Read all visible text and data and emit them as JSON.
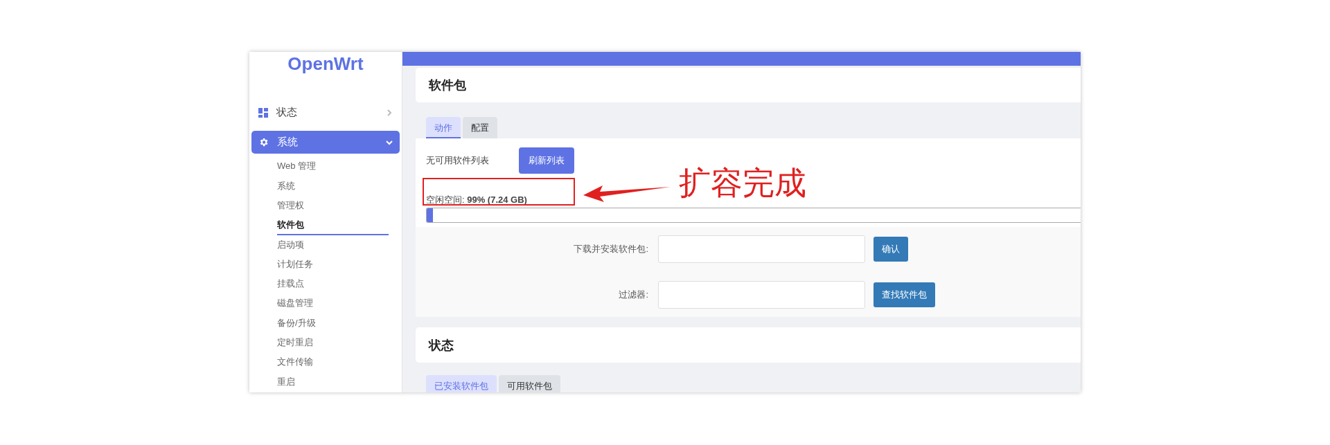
{
  "sidebar": {
    "logo": "OpenWrt",
    "menu": [
      {
        "label": "状态",
        "expanded": false,
        "selected": false
      },
      {
        "label": "系统",
        "expanded": true,
        "selected": true
      }
    ],
    "submenu": [
      {
        "label": "Web 管理",
        "selected": false
      },
      {
        "label": "系统",
        "selected": false
      },
      {
        "label": "管理权",
        "selected": false
      },
      {
        "label": "软件包",
        "selected": true
      },
      {
        "label": "启动项",
        "selected": false
      },
      {
        "label": "计划任务",
        "selected": false
      },
      {
        "label": "挂载点",
        "selected": false
      },
      {
        "label": "磁盘管理",
        "selected": false
      },
      {
        "label": "备份/升级",
        "selected": false
      },
      {
        "label": "定时重启",
        "selected": false
      },
      {
        "label": "文件传输",
        "selected": false
      },
      {
        "label": "重启",
        "selected": false
      }
    ]
  },
  "page_title": "软件包",
  "tabs": [
    {
      "label": "动作",
      "selected": true
    },
    {
      "label": "配置",
      "selected": false
    }
  ],
  "actions": {
    "message": "无可用软件列表",
    "refresh_button": "刷新列表",
    "free_space_label": "空闲空间:",
    "free_space_value": "99% (7.24 GB)",
    "level": 0.01
  },
  "form": [
    {
      "label": "下载并安装软件包:",
      "button": "确认"
    },
    {
      "label": "过滤器:",
      "button": "查找软件包"
    }
  ],
  "status_title": "状态",
  "status_tabs": [
    {
      "label": "已安装软件包",
      "selected": true
    },
    {
      "label": "可用软件包",
      "selected": false
    }
  ],
  "annotation": {
    "text": "扩容完成"
  }
}
